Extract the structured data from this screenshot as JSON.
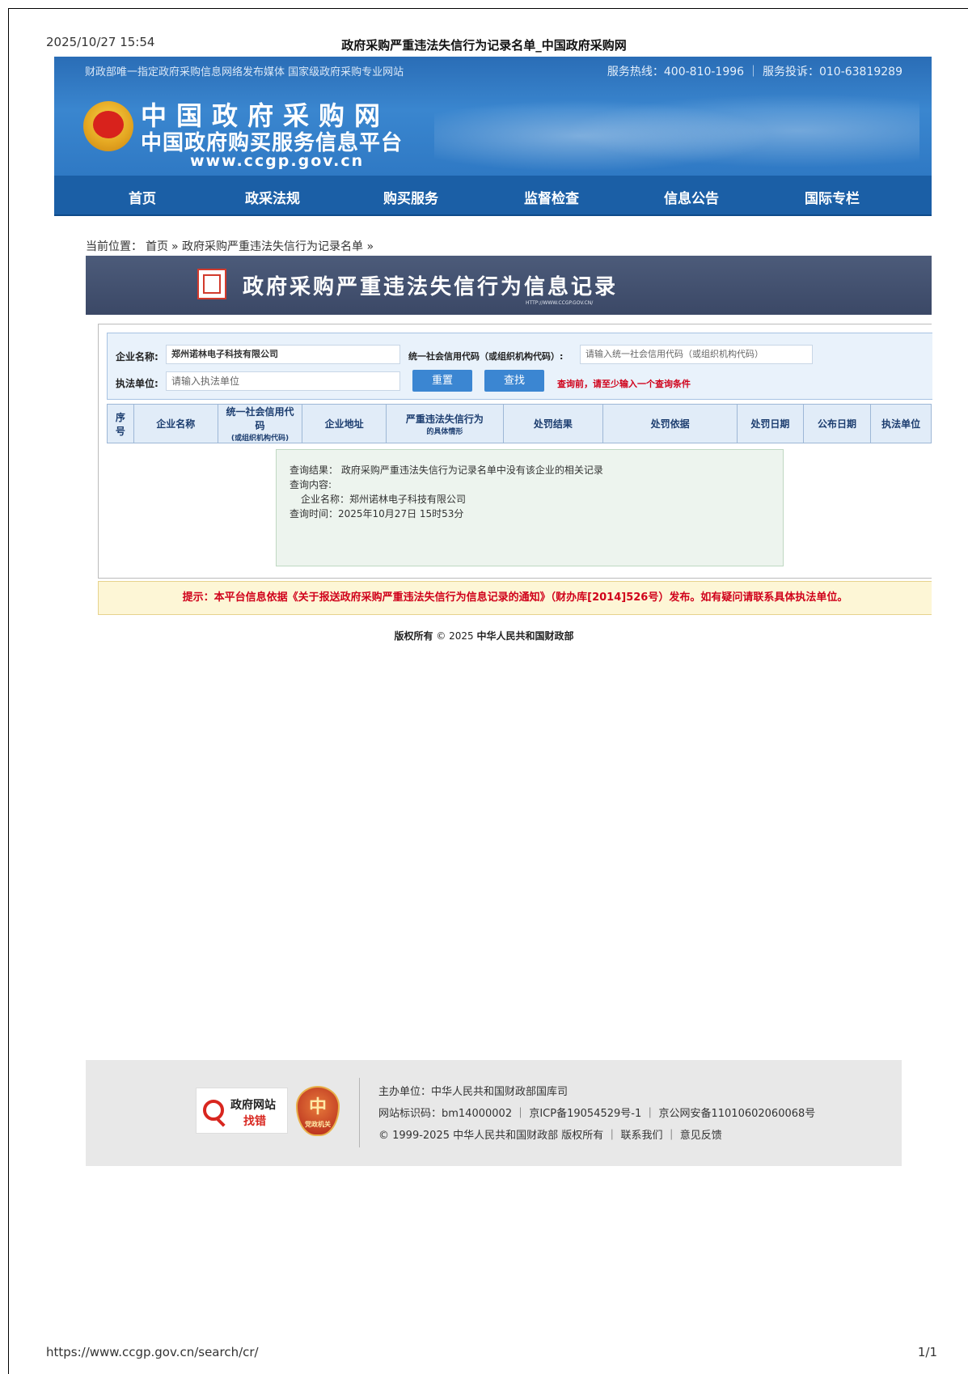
{
  "print": {
    "date": "2025/10/27 15:54",
    "title": "政府采购严重违法失信行为记录名单_中国政府采购网",
    "url": "https://www.ccgp.gov.cn/search/cr/",
    "page": "1/1"
  },
  "header": {
    "topline": "财政部唯一指定政府采购信息网络发布媒体 国家级政府采购专业网站",
    "hotline": "服务热线：400-810-1996 ｜ 服务投诉：010-63819289",
    "logo_line1": "中国政府采购网",
    "logo_line2": "中国政府购买服务信息平台",
    "logo_url": "www.ccgp.gov.cn"
  },
  "nav": {
    "items": [
      "首页",
      "政采法规",
      "购买服务",
      "监督检查",
      "信息公告",
      "国际专栏"
    ]
  },
  "breadcrumb": {
    "prefix": "当前位置：",
    "home": "首页",
    "current": "» 政府采购严重违法失信行为记录名单 »"
  },
  "record_banner": {
    "title": "政府采购严重违法失信行为信息记录",
    "url": "HTTP://WWW.CCGP.GOV.CN/"
  },
  "search": {
    "company_label": "企业名称:",
    "company_value": "郑州诺林电子科技有限公司",
    "credit_label": "统一社会信用代码（或组织机构代码）:",
    "credit_placeholder": "请输入统一社会信用代码（或组织机构代码）",
    "unit_label": "执法单位:",
    "unit_placeholder": "请输入执法单位",
    "reset_label": "重置",
    "search_label": "查找",
    "warning": "查询前，请至少输入一个查询条件"
  },
  "table": {
    "headers": [
      {
        "main": "序号",
        "sub": ""
      },
      {
        "main": "企业名称",
        "sub": ""
      },
      {
        "main": "统一社会信用代码",
        "sub": "(或组织机构代码)"
      },
      {
        "main": "企业地址",
        "sub": ""
      },
      {
        "main": "严重违法失信行为",
        "sub": "的具体情形"
      },
      {
        "main": "处罚结果",
        "sub": ""
      },
      {
        "main": "处罚依据",
        "sub": ""
      },
      {
        "main": "处罚日期",
        "sub": ""
      },
      {
        "main": "公布日期",
        "sub": ""
      },
      {
        "main": "执法单位",
        "sub": ""
      }
    ]
  },
  "notice": {
    "result": "查询结果：  政府采购严重违法失信行为记录名单中没有该企业的相关记录",
    "content_label": "查询内容:",
    "company": "企业名称：郑州诺林电子科技有限公司",
    "time": "查询时间：2025年10月27日 15时53分"
  },
  "tip": "提示：本平台信息依据《关于报送政府采购严重违法失信行为信息记录的通知》（财办库[2014]526号）发布。如有疑问请联系具体执法单位。",
  "copyright": {
    "prefix": "版权所有",
    "year": "© 2025",
    "owner": "中华人民共和国财政部"
  },
  "footer": {
    "badge_line1": "政府网站",
    "badge_line2": "找错",
    "shield_text": "党政机关",
    "shield_glyph": "中",
    "host": "主办单位：中华人民共和国财政部国库司",
    "ids": "网站标识码：bm14000002 ｜ 京ICP备19054529号-1 ｜ 京公网安备11010602060068号",
    "rights": "© 1999-2025 中华人民共和国财政部 版权所有 ｜ 联系我们 ｜ 意见反馈"
  },
  "colors": {
    "banner": "#2f79c4",
    "nav": "#1b5fa6",
    "record_banner": "#44506f",
    "warning": "#d0021b",
    "button": "#3b86d2"
  }
}
